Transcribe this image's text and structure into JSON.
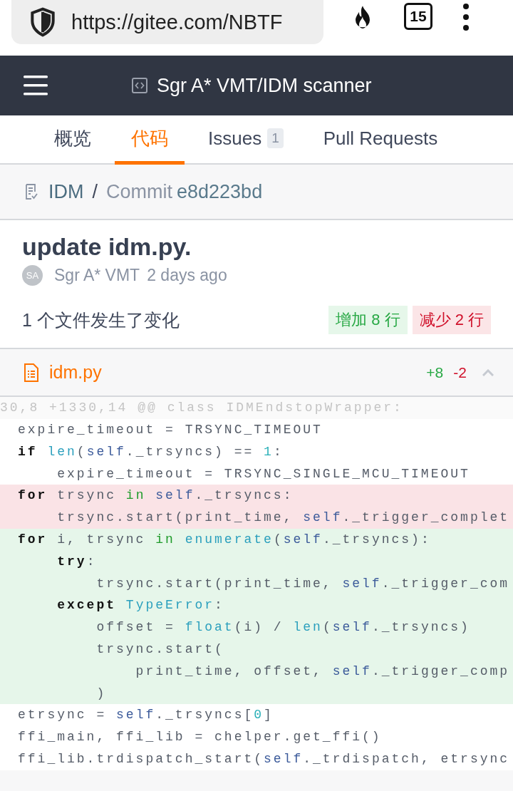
{
  "browser": {
    "url": "https://gitee.com/NBTF",
    "tab_count": "15"
  },
  "header": {
    "title": "Sgr A* VMT/IDM scanner"
  },
  "tabs": [
    {
      "label": "概览",
      "selected": false
    },
    {
      "label": "代码",
      "selected": true
    },
    {
      "label": "Issues",
      "badge": "1",
      "selected": false
    },
    {
      "label": "Pull Requests",
      "selected": false
    }
  ],
  "breadcrumb": {
    "repo": "IDM",
    "separator": "/",
    "commit_label": "Commit",
    "commit_hash": "e8d223bd"
  },
  "commit": {
    "title": "update idm.py.",
    "avatar": "SA",
    "author": "Sgr A* VMT",
    "time": "2 days ago"
  },
  "summary": {
    "text": "1 个文件发生了变化",
    "added": "增加 8 行",
    "removed": "减少 2 行"
  },
  "file": {
    "name": "idm.py",
    "added": "+8",
    "removed": "-2",
    "expanded": true
  },
  "hunk_header": "30,8 +1330,14 @@ class IDMEndstopWrapper:",
  "code_lines": [
    {
      "kind": "context",
      "tokens": [
        {
          "kind": "plain",
          "text": "expire_timeout = TRSYNC_TIMEOUT"
        }
      ]
    },
    {
      "kind": "context",
      "tokens": [
        {
          "kind": "keyword",
          "text": "if"
        },
        {
          "kind": "builtin",
          "text": " len"
        },
        {
          "kind": "plain",
          "text": "("
        },
        {
          "kind": "self",
          "text": "self"
        },
        {
          "kind": "plain",
          "text": "._trsyncs) == "
        },
        {
          "kind": "number",
          "text": "1"
        },
        {
          "kind": "plain",
          "text": ":"
        }
      ]
    },
    {
      "kind": "context",
      "tokens": [
        {
          "kind": "plain",
          "text": "    expire_timeout = TRSYNC_SINGLE_MCU_TIMEOUT"
        }
      ]
    },
    {
      "kind": "removed",
      "tokens": [
        {
          "kind": "keyword",
          "text": "for"
        },
        {
          "kind": "plain",
          "text": " trsync "
        },
        {
          "kind": "in",
          "text": "in"
        },
        {
          "kind": "self",
          "text": " self"
        },
        {
          "kind": "plain",
          "text": "._trsyncs:"
        }
      ]
    },
    {
      "kind": "removed",
      "tokens": [
        {
          "kind": "plain",
          "text": "    trsync.start(print_time, "
        },
        {
          "kind": "self",
          "text": "self"
        },
        {
          "kind": "plain",
          "text": "._trigger_complet"
        }
      ]
    },
    {
      "kind": "added",
      "tokens": [
        {
          "kind": "keyword",
          "text": "for"
        },
        {
          "kind": "plain",
          "text": " i, trsync "
        },
        {
          "kind": "in",
          "text": "in"
        },
        {
          "kind": "builtin",
          "text": " enumerate"
        },
        {
          "kind": "plain",
          "text": "("
        },
        {
          "kind": "self",
          "text": "self"
        },
        {
          "kind": "plain",
          "text": "._trsyncs):"
        }
      ]
    },
    {
      "kind": "added",
      "tokens": [
        {
          "kind": "keyword",
          "text": "    try"
        },
        {
          "kind": "plain",
          "text": ":"
        }
      ]
    },
    {
      "kind": "added",
      "tokens": [
        {
          "kind": "plain",
          "text": "        trsync.start(print_time, "
        },
        {
          "kind": "self",
          "text": "self"
        },
        {
          "kind": "plain",
          "text": "._trigger_com"
        }
      ]
    },
    {
      "kind": "added",
      "tokens": [
        {
          "kind": "keyword",
          "text": "    except"
        },
        {
          "kind": "builtin",
          "text": " TypeError"
        },
        {
          "kind": "plain",
          "text": ":"
        }
      ]
    },
    {
      "kind": "added",
      "tokens": [
        {
          "kind": "plain",
          "text": "        offset = "
        },
        {
          "kind": "builtin",
          "text": "float"
        },
        {
          "kind": "plain",
          "text": "(i) / "
        },
        {
          "kind": "builtin",
          "text": "len"
        },
        {
          "kind": "plain",
          "text": "("
        },
        {
          "kind": "self",
          "text": "self"
        },
        {
          "kind": "plain",
          "text": "._trsyncs)"
        }
      ]
    },
    {
      "kind": "added",
      "tokens": [
        {
          "kind": "plain",
          "text": "        trsync.start("
        }
      ]
    },
    {
      "kind": "added",
      "tokens": [
        {
          "kind": "plain",
          "text": "            print_time, offset, "
        },
        {
          "kind": "self",
          "text": "self"
        },
        {
          "kind": "plain",
          "text": "._trigger_comp"
        }
      ]
    },
    {
      "kind": "added",
      "tokens": [
        {
          "kind": "plain",
          "text": "        )"
        }
      ]
    },
    {
      "kind": "context",
      "tokens": [
        {
          "kind": "plain",
          "text": "etrsync = "
        },
        {
          "kind": "self",
          "text": "self"
        },
        {
          "kind": "plain",
          "text": "._trsyncs["
        },
        {
          "kind": "number",
          "text": "0"
        },
        {
          "kind": "plain",
          "text": "]"
        }
      ]
    },
    {
      "kind": "context",
      "tokens": [
        {
          "kind": "plain",
          "text": "ffi_main, ffi_lib = chelper.get_ffi()"
        }
      ]
    },
    {
      "kind": "context",
      "tokens": [
        {
          "kind": "plain",
          "text": "ffi_lib.trdispatch_start("
        },
        {
          "kind": "self",
          "text": "self"
        },
        {
          "kind": "plain",
          "text": "._trdispatch, etrsync"
        }
      ]
    }
  ]
}
